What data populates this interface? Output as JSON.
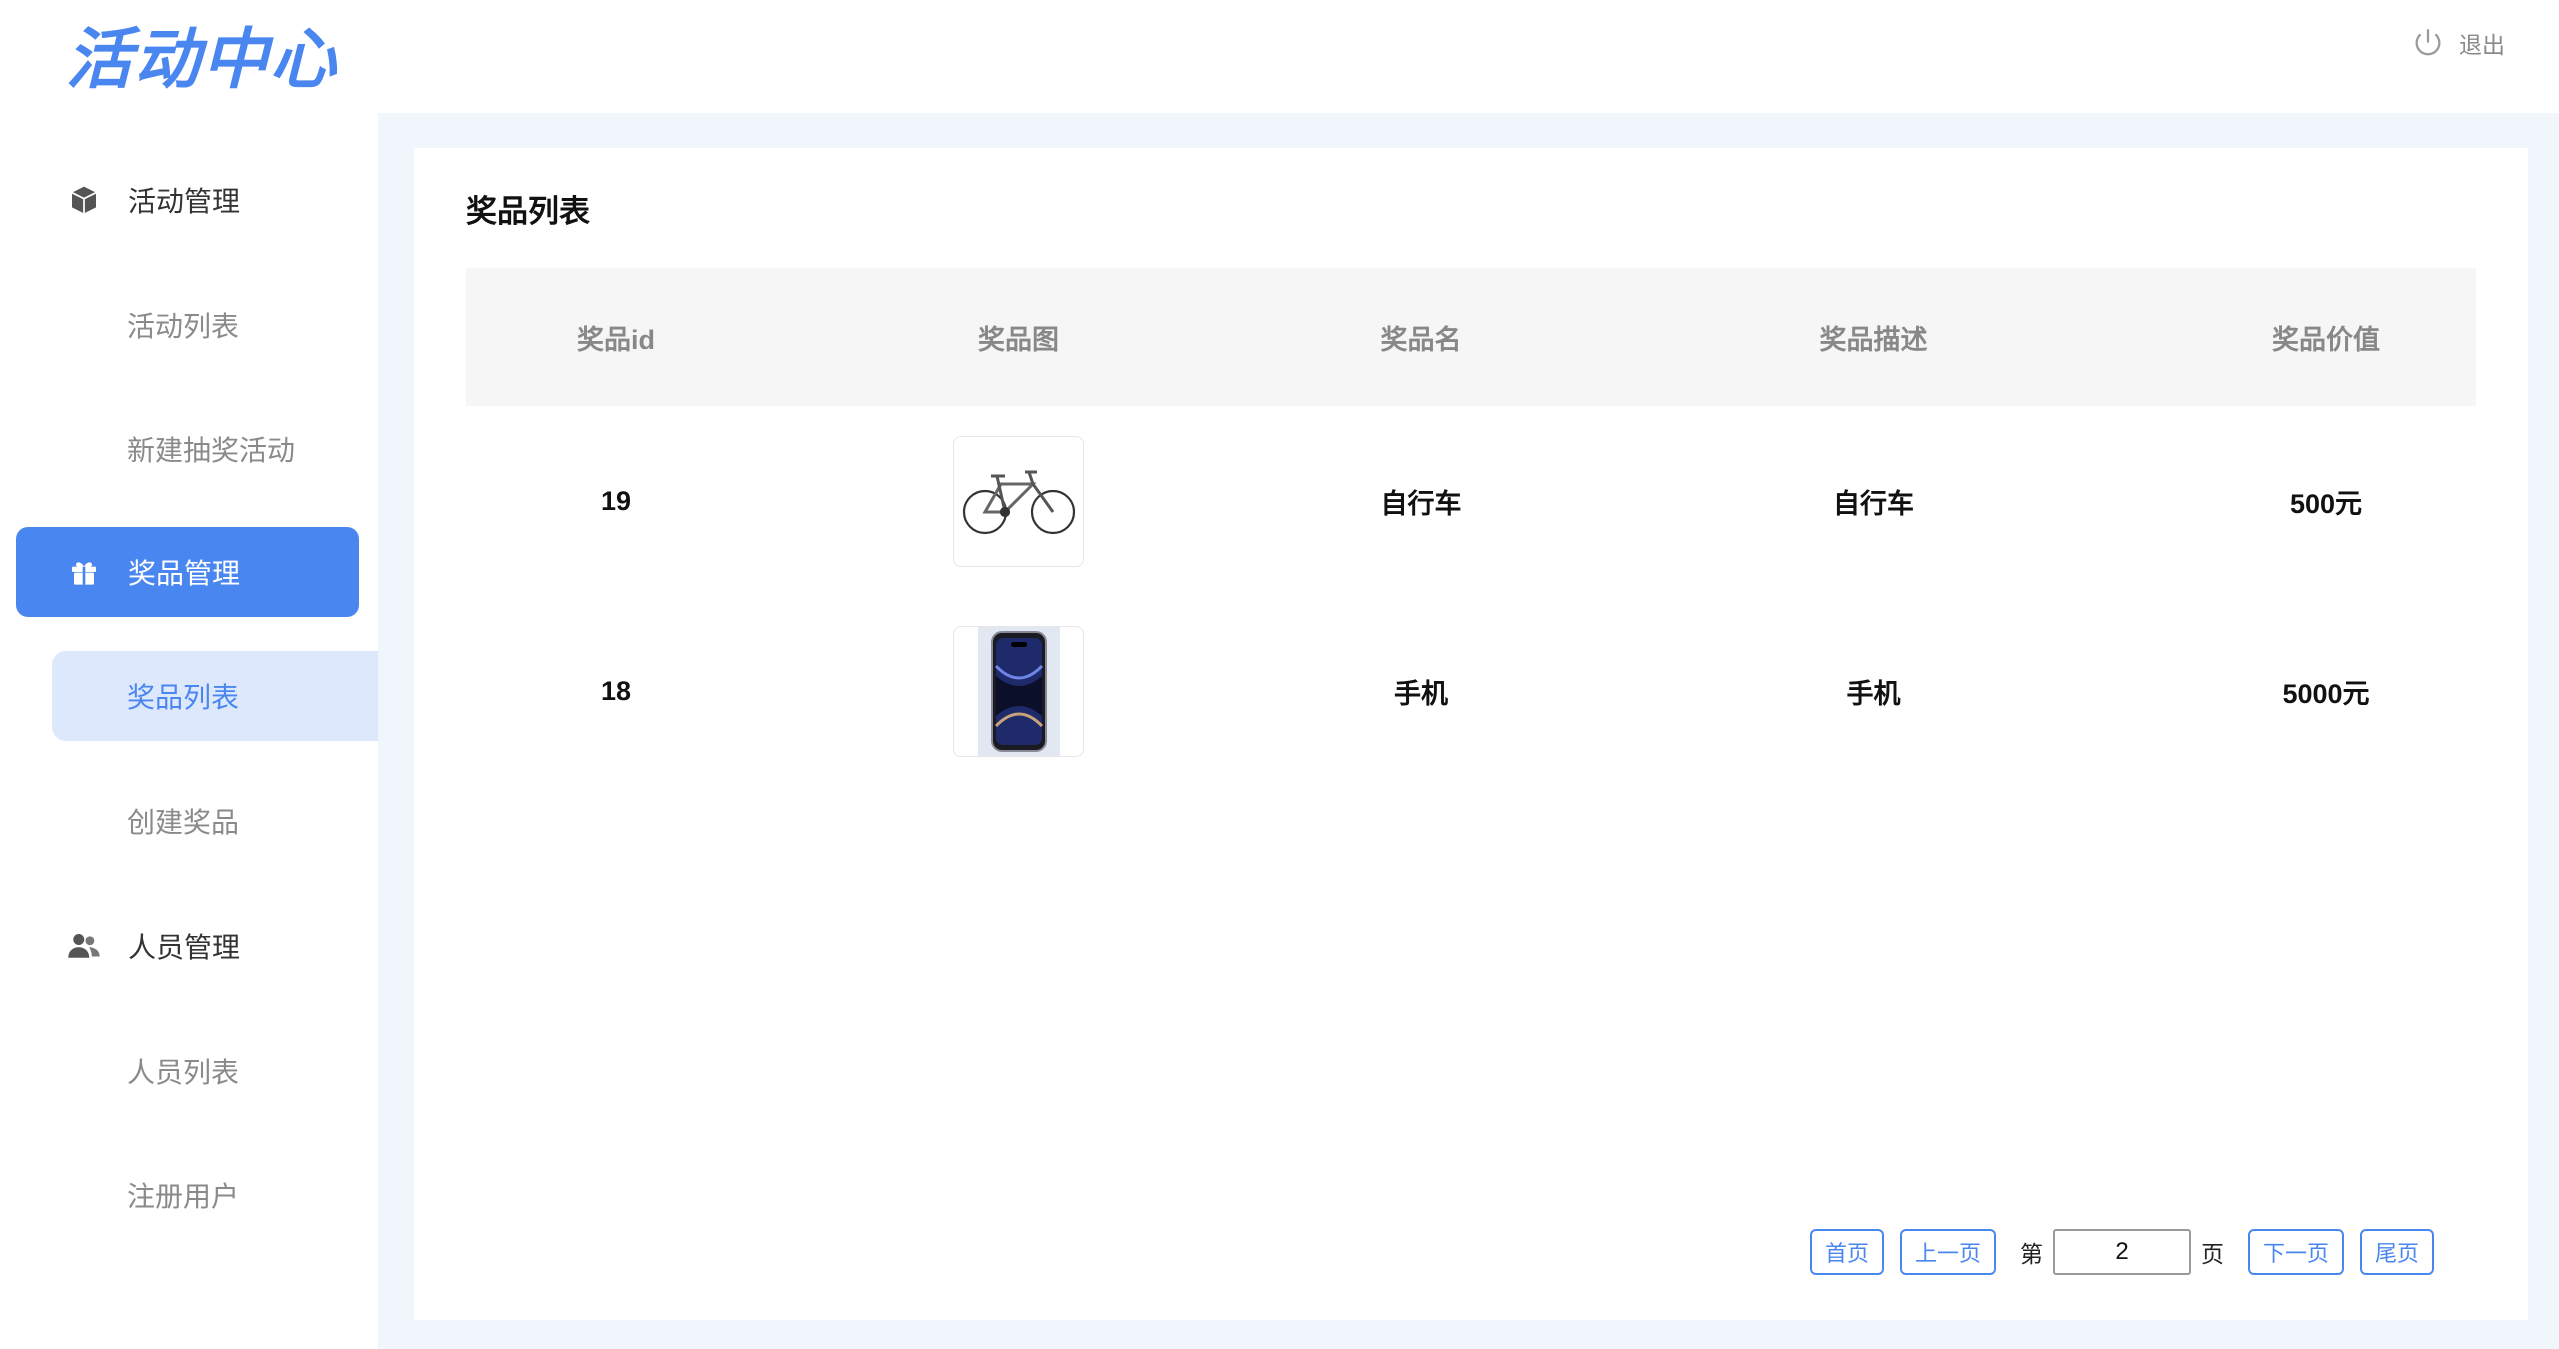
{
  "header": {
    "logo": "活动中心",
    "logout_label": "退出"
  },
  "sidebar": {
    "groups": [
      {
        "label": "活动管理",
        "icon": "cube-icon",
        "items": [
          {
            "label": "活动列表"
          },
          {
            "label": "新建抽奖活动"
          }
        ]
      },
      {
        "label": "奖品管理",
        "icon": "gift-icon",
        "items": [
          {
            "label": "奖品列表"
          },
          {
            "label": "创建奖品"
          }
        ]
      },
      {
        "label": "人员管理",
        "icon": "users-icon",
        "items": [
          {
            "label": "人员列表"
          },
          {
            "label": "注册用户"
          }
        ]
      }
    ],
    "active_group": "奖品管理",
    "active_item": "奖品列表"
  },
  "main": {
    "title": "奖品列表",
    "columns": [
      "奖品id",
      "奖品图",
      "奖品名",
      "奖品描述",
      "奖品价值"
    ],
    "rows": [
      {
        "id": "19",
        "image": "bicycle-image",
        "name": "自行车",
        "description": "自行车",
        "value": "500元"
      },
      {
        "id": "18",
        "image": "phone-image",
        "name": "手机",
        "description": "手机",
        "value": "5000元"
      }
    ]
  },
  "pagination": {
    "first": "首页",
    "prev": "上一页",
    "page_prefix": "第",
    "current_page": "2",
    "page_suffix": "页",
    "next": "下一页",
    "last": "尾页"
  },
  "colors": {
    "accent": "#4a86f0",
    "active_item_bg": "#dde8fd",
    "main_bg": "#f1f5fc"
  }
}
